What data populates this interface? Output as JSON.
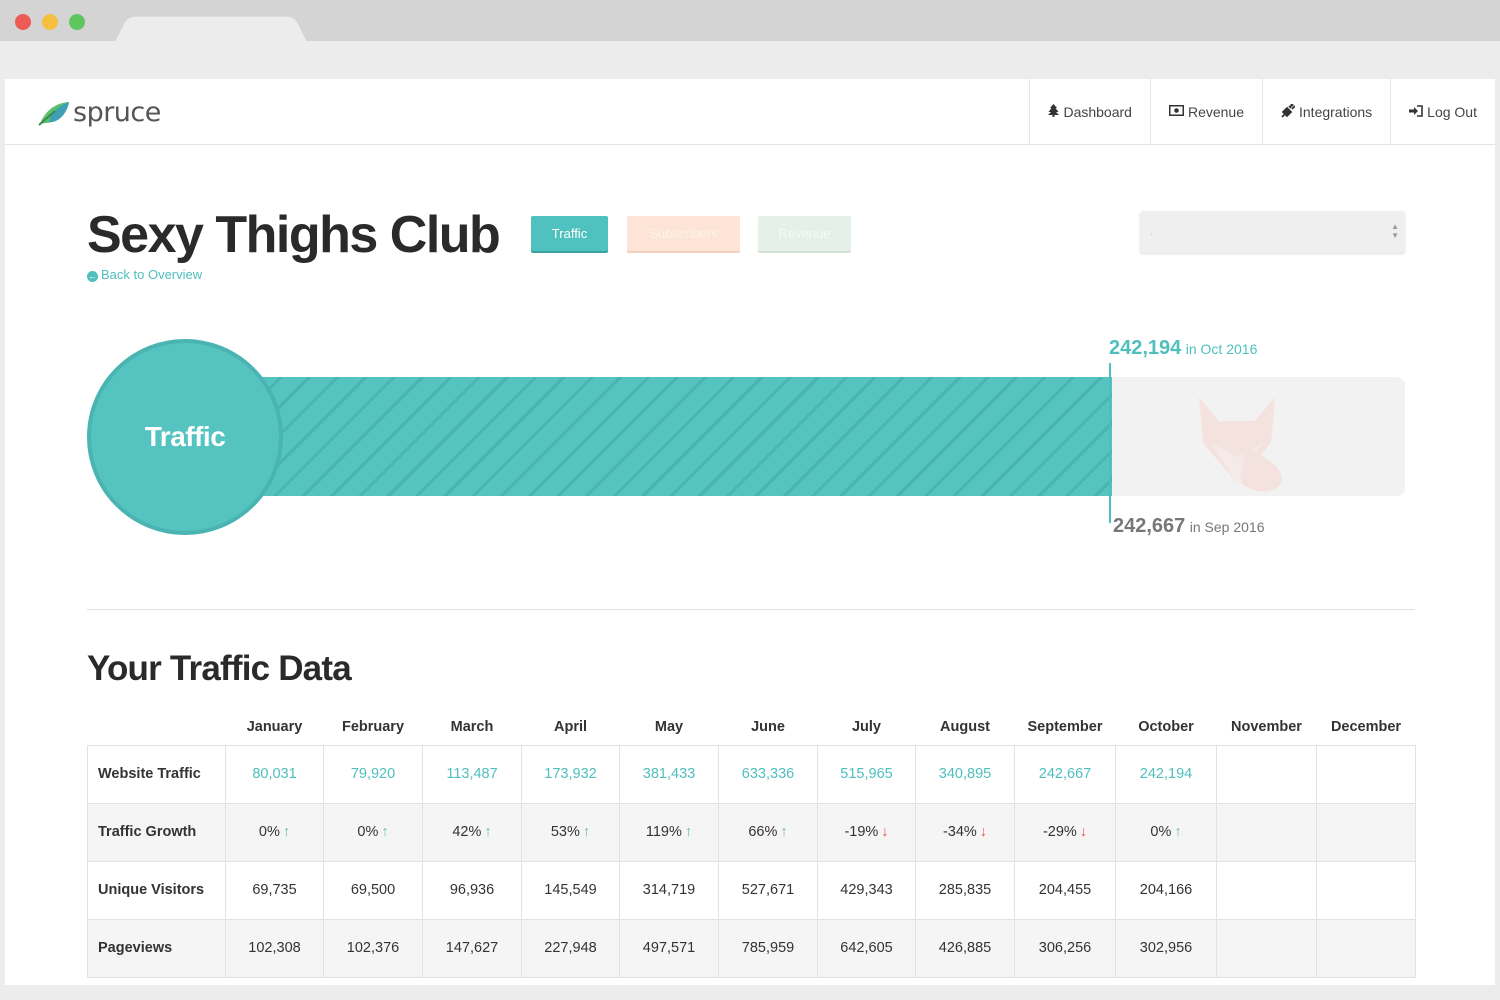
{
  "nav": {
    "logo_text": "spruce",
    "items": [
      {
        "icon": "tree-icon",
        "label": "Dashboard"
      },
      {
        "icon": "money-icon",
        "label": "Revenue"
      },
      {
        "icon": "plug-icon",
        "label": "Integrations"
      },
      {
        "icon": "sign-in-icon",
        "label": "Log Out"
      }
    ]
  },
  "header": {
    "title": "Sexy Thighs Club",
    "back_link": "Back to Overview",
    "tabs": [
      "Traffic",
      "Subscribers",
      "Revenue"
    ],
    "select_value": "."
  },
  "metric": {
    "label": "Traffic",
    "current_value": "242,194",
    "current_period": "in Oct 2016",
    "previous_value": "242,667",
    "previous_period": "in Sep 2016",
    "progress_fraction": 0.745
  },
  "colors": {
    "accent": "#4fbfbd",
    "up": "#6cc28a",
    "down": "#e8584d"
  },
  "section": {
    "title": "Your Traffic Data"
  },
  "table": {
    "columns": [
      "January",
      "February",
      "March",
      "April",
      "May",
      "June",
      "July",
      "August",
      "September",
      "October",
      "November",
      "December"
    ],
    "rows": [
      {
        "label": "Website Traffic",
        "values": [
          "80,031",
          "79,920",
          "113,487",
          "173,932",
          "381,433",
          "633,336",
          "515,965",
          "340,895",
          "242,667",
          "242,194",
          "",
          ""
        ]
      },
      {
        "label": "Traffic Growth",
        "values": [
          "0%",
          "0%",
          "42%",
          "53%",
          "119%",
          "66%",
          "-19%",
          "-34%",
          "-29%",
          "0%",
          "",
          ""
        ],
        "trend": [
          "up",
          "up",
          "up",
          "up",
          "up",
          "up",
          "down",
          "down",
          "down",
          "up",
          "",
          ""
        ]
      },
      {
        "label": "Unique Visitors",
        "values": [
          "69,735",
          "69,500",
          "96,936",
          "145,549",
          "314,719",
          "527,671",
          "429,343",
          "285,835",
          "204,455",
          "204,166",
          "",
          ""
        ]
      },
      {
        "label": "Pageviews",
        "values": [
          "102,308",
          "102,376",
          "147,627",
          "227,948",
          "497,571",
          "785,959",
          "642,605",
          "426,885",
          "306,256",
          "302,956",
          "",
          ""
        ]
      }
    ]
  }
}
